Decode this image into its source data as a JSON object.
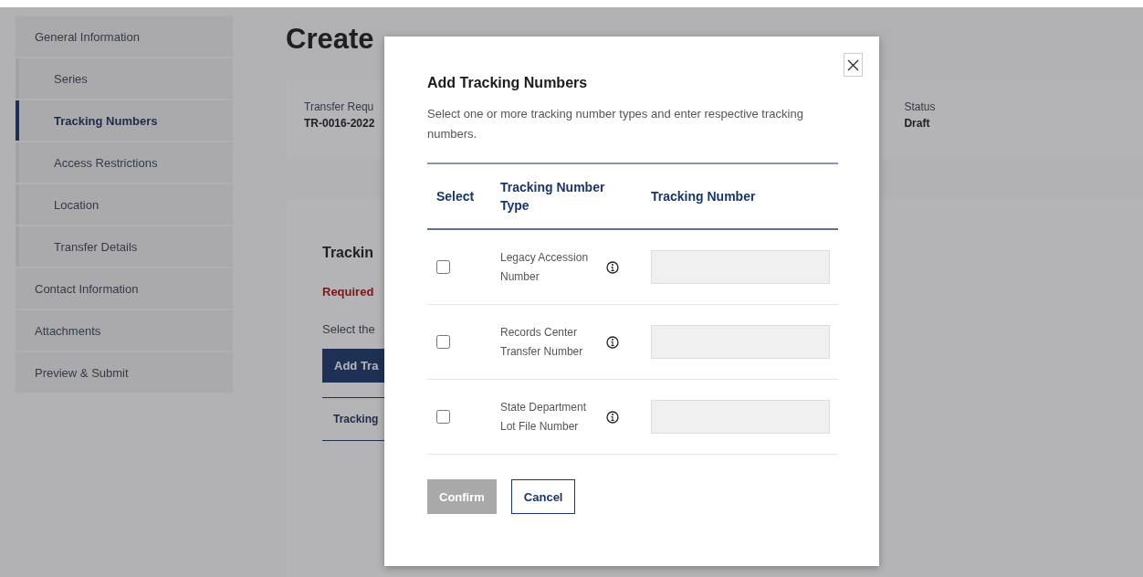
{
  "sidebar": {
    "items": [
      {
        "label": "General Information",
        "selected": false,
        "children": [
          {
            "label": "Series",
            "selected": false
          },
          {
            "label": "Tracking Numbers",
            "selected": true
          },
          {
            "label": "Access Restrictions",
            "selected": false
          },
          {
            "label": "Location",
            "selected": false
          },
          {
            "label": "Transfer Details",
            "selected": false
          }
        ]
      },
      {
        "label": "Contact Information",
        "selected": false
      },
      {
        "label": "Attachments",
        "selected": false
      },
      {
        "label": "Preview & Submit",
        "selected": false
      }
    ]
  },
  "page_title": "Create",
  "summary": {
    "fields": [
      {
        "label": "Transfer Requ",
        "value": "TR-0016-2022"
      },
      {
        "label": "Status",
        "value": "Draft"
      }
    ]
  },
  "section": {
    "title": "Trackin",
    "required": "Required",
    "instruction": "Select the",
    "add_button": "Add Tra",
    "table_header": "Tracking"
  },
  "modal": {
    "title": "Add Tracking Numbers",
    "description": "Select one or more tracking number types and enter respective tracking numbers.",
    "columns": [
      "Select",
      "Tracking Number Type",
      "Tracking Number"
    ],
    "rows": [
      {
        "type": "Legacy Accession Number",
        "checked": false
      },
      {
        "type": "Records Center Transfer Number",
        "checked": false
      },
      {
        "type": "State Department Lot File Number",
        "checked": false
      }
    ],
    "confirm": {
      "label": "Confirm",
      "disabled": true
    },
    "cancel": "Cancel"
  }
}
